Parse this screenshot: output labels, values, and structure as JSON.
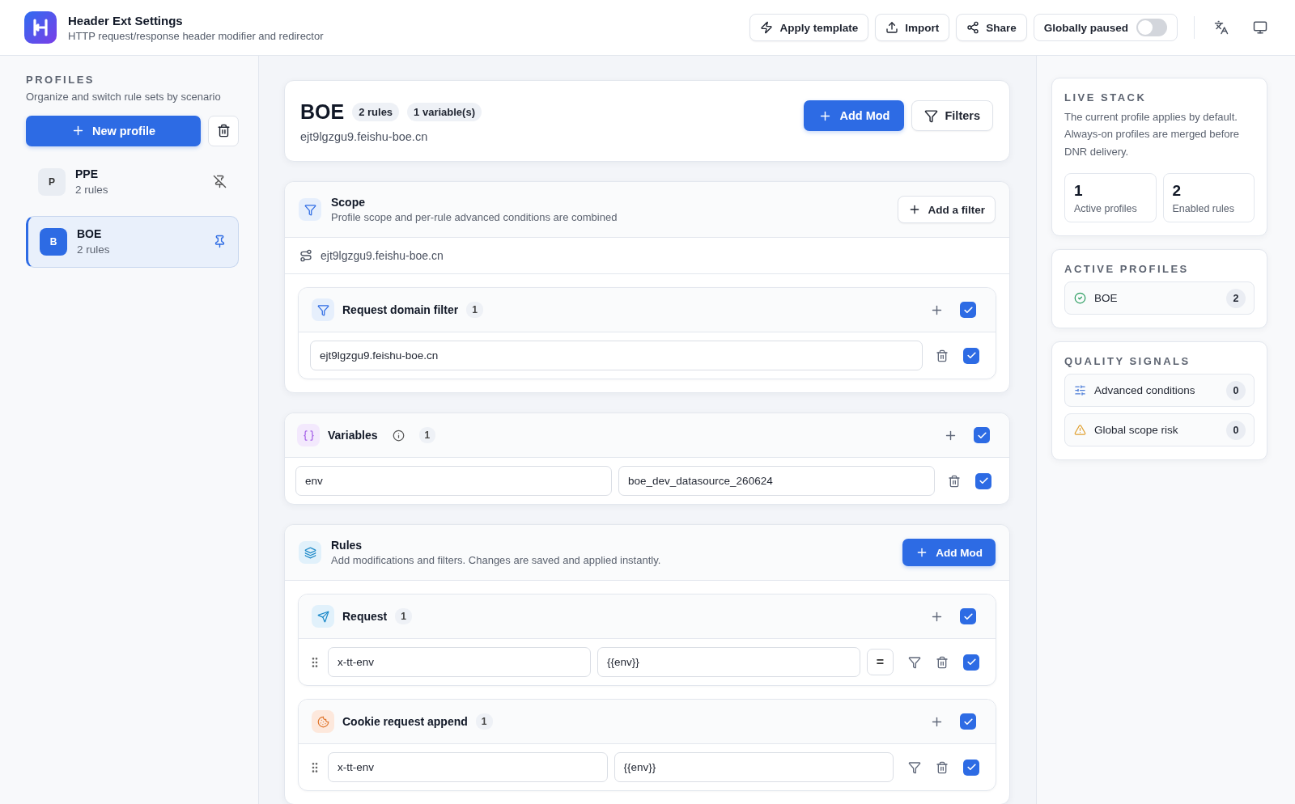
{
  "app": {
    "title": "Header Ext Settings",
    "subtitle": "HTTP request/response header modifier and redirector"
  },
  "toolbar": {
    "buttons": [
      {
        "kind": "template",
        "label": "Apply template"
      },
      {
        "kind": "import",
        "label": "Import"
      },
      {
        "kind": "share",
        "label": "Share"
      }
    ],
    "pause": {
      "label": "Globally paused",
      "on": false
    }
  },
  "sidebar": {
    "heading": "PROFILES",
    "description": "Organize and switch rule sets by scenario",
    "new_button": "New profile",
    "profiles": [
      {
        "initial": "P",
        "name": "PPE",
        "count": "2 rules",
        "selected": false,
        "pinned": false
      },
      {
        "initial": "B",
        "name": "BOE",
        "count": "2 rules",
        "selected": true,
        "pinned": true
      }
    ]
  },
  "profile": {
    "name": "BOE",
    "badges": [
      "2 rules",
      "1 variable(s)"
    ],
    "domain": "ejt9lgzgu9.feishu-boe.cn",
    "add_button": "Add Mod",
    "filters_button": "Filters"
  },
  "scope": {
    "title": "Scope",
    "description": "Profile scope and per-rule advanced conditions are combined",
    "add_button": "Add a filter",
    "domain": "ejt9lgzgu9.feishu-boe.cn",
    "group": {
      "title": "Request domain filter",
      "count": "1",
      "enabled": true,
      "items": [
        {
          "value": "ejt9lgzgu9.feishu-boe.cn",
          "enabled": true
        }
      ]
    }
  },
  "variables": {
    "title": "Variables",
    "count": "1",
    "enabled": true,
    "items": [
      {
        "name": "env",
        "value": "boe_dev_datasource_260624",
        "enabled": true
      }
    ]
  },
  "rules": {
    "title": "Rules",
    "description": "Add modifications and filters. Changes are saved and applied instantly.",
    "add_button": "Add Mod",
    "groups": [
      {
        "kind": "request",
        "title": "Request",
        "count": "1",
        "enabled": true,
        "items": [
          {
            "name": "x-tt-env",
            "value": "{{env}}",
            "operator": "=",
            "enabled": true
          }
        ]
      },
      {
        "kind": "cookie",
        "title": "Cookie request append",
        "count": "1",
        "enabled": true,
        "items": [
          {
            "name": "x-tt-env",
            "value": "{{env}}",
            "enabled": true
          }
        ]
      }
    ]
  },
  "live_stack": {
    "heading": "LIVE STACK",
    "description": "The current profile applies by default. Always-on profiles are merged before DNR delivery.",
    "stats": [
      {
        "value": "1",
        "label": "Active profiles"
      },
      {
        "value": "2",
        "label": "Enabled rules"
      }
    ]
  },
  "active_profiles": {
    "heading": "ACTIVE PROFILES",
    "items": [
      {
        "name": "BOE",
        "count": "2"
      }
    ]
  },
  "quality_signals": {
    "heading": "QUALITY SIGNALS",
    "items": [
      {
        "kind": "conditions",
        "label": "Advanced conditions",
        "count": "0"
      },
      {
        "kind": "risk",
        "label": "Global scope risk",
        "count": "0"
      }
    ]
  }
}
